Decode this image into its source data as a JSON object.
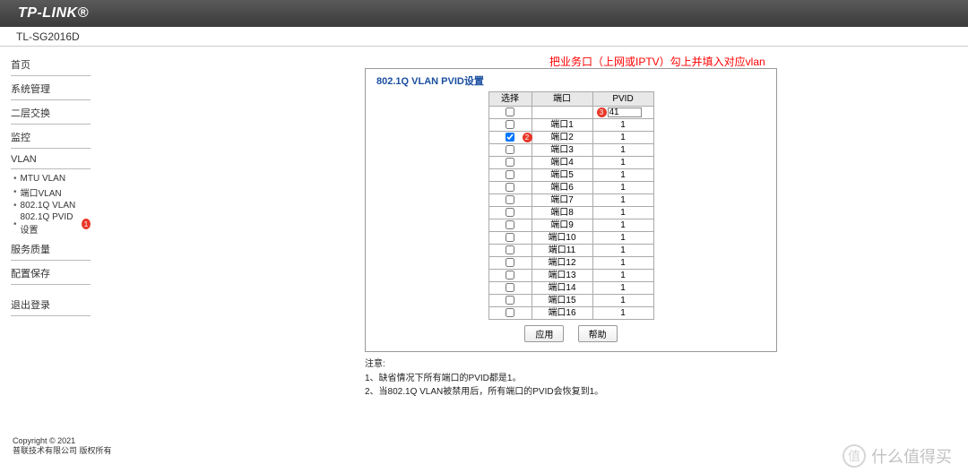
{
  "header": {
    "brand": "TP-LINK®"
  },
  "subheader": {
    "model": "TL-SG2016D"
  },
  "sidebar": {
    "items": {
      "home": "首页",
      "sysmgmt": "系统管理",
      "l2switch": "二层交换",
      "monitor": "监控",
      "vlan": "VLAN",
      "mtuvlan": "MTU VLAN",
      "portvlan": "端口VLAN",
      "dot1qvlan": "802.1Q VLAN",
      "pvid": "802.1Q PVID设置",
      "qos": "服务质量",
      "cfgsave": "配置保存",
      "logout": "退出登录"
    },
    "badge1": "1",
    "copyright1": "Copyright © 2021",
    "copyright2": "普联技术有限公司 版权所有"
  },
  "annotation": "把业务口（上网或IPTV）勾上并填入对应vlan",
  "panel": {
    "legend": "802.1Q VLAN PVID设置",
    "th_sel": "选择",
    "th_port": "端口",
    "th_pvid": "PVID",
    "pvid_input": "41",
    "badge2": "2",
    "badge3": "3",
    "rows": [
      {
        "checked": false,
        "port": "端口1",
        "pvid": "1"
      },
      {
        "checked": true,
        "port": "端口2",
        "pvid": "1"
      },
      {
        "checked": false,
        "port": "端口3",
        "pvid": "1"
      },
      {
        "checked": false,
        "port": "端口4",
        "pvid": "1"
      },
      {
        "checked": false,
        "port": "端口5",
        "pvid": "1"
      },
      {
        "checked": false,
        "port": "端口6",
        "pvid": "1"
      },
      {
        "checked": false,
        "port": "端口7",
        "pvid": "1"
      },
      {
        "checked": false,
        "port": "端口8",
        "pvid": "1"
      },
      {
        "checked": false,
        "port": "端口9",
        "pvid": "1"
      },
      {
        "checked": false,
        "port": "端口10",
        "pvid": "1"
      },
      {
        "checked": false,
        "port": "端口11",
        "pvid": "1"
      },
      {
        "checked": false,
        "port": "端口12",
        "pvid": "1"
      },
      {
        "checked": false,
        "port": "端口13",
        "pvid": "1"
      },
      {
        "checked": false,
        "port": "端口14",
        "pvid": "1"
      },
      {
        "checked": false,
        "port": "端口15",
        "pvid": "1"
      },
      {
        "checked": false,
        "port": "端口16",
        "pvid": "1"
      }
    ],
    "btn_apply": "应用",
    "btn_help": "帮助"
  },
  "notes": {
    "title": "注意:",
    "n1": "1、缺省情况下所有端口的PVID都是1。",
    "n2": "2、当802.1Q VLAN被禁用后，所有端口的PVID会恢复到1。"
  },
  "watermark": {
    "icon": "值",
    "text": "什么值得买"
  }
}
